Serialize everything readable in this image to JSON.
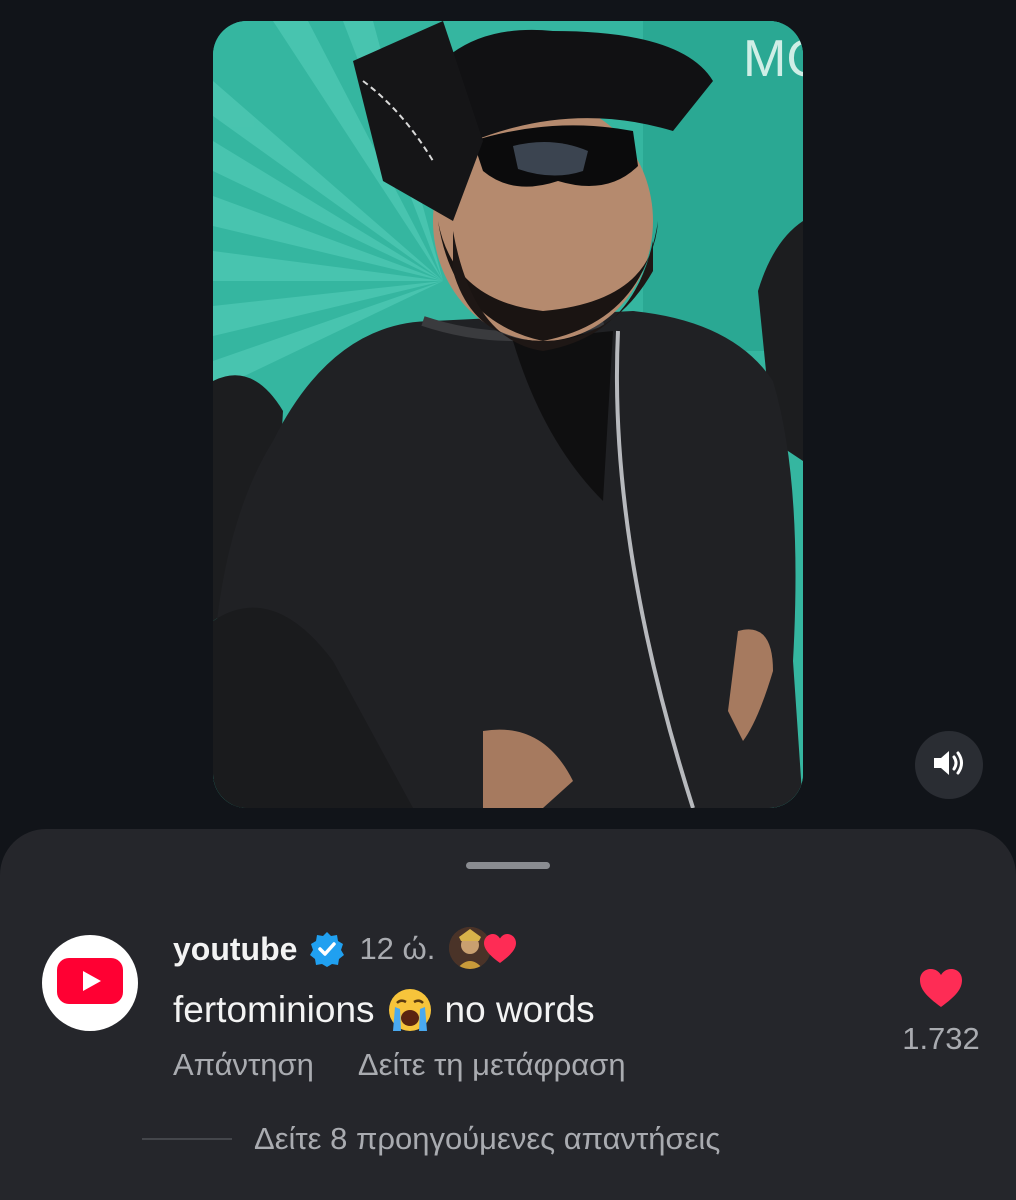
{
  "video": {
    "description_icon": "video-thumbnail",
    "mute_icon": "speaker-volume-icon"
  },
  "comment": {
    "username": "youtube",
    "verified_icon": "verified-badge-icon",
    "time": "12 ώ.",
    "creator_liked_icon": "creator-heart-icon",
    "text_before_emoji": "fertominions",
    "emoji": "loudly-crying-face",
    "text_after_emoji": "no words",
    "reply_label": "Απάντηση",
    "translate_label": "Δείτε τη μετάφραση",
    "like_count": "1.732"
  },
  "replies": {
    "view_label": "Δείτε 8 προηγούμενες απαντήσεις"
  },
  "colors": {
    "background": "#111419",
    "sheet": "#25262b",
    "primary_text": "#f3f3f3",
    "secondary_text": "#a9abb0",
    "heart": "#fe2c55",
    "verified": "#20a0f0",
    "youtube_red": "#ff0033"
  }
}
